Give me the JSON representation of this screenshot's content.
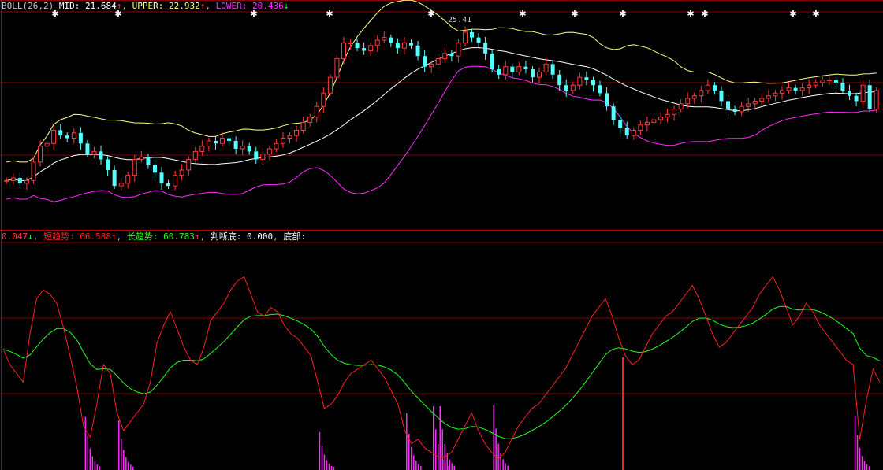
{
  "colors": {
    "background": "#000000",
    "grid": "#8b0000",
    "up_candle": "#ff3c3c",
    "down_candle": "#54ffff",
    "mid_band": "#ffffff",
    "upper_band": "#ffff80",
    "lower_band": "#ff2cff",
    "short_trend": "#ff2020",
    "long_trend": "#20ff20",
    "bottom_hist": "#ff2cff",
    "signal_line": "#ff2020"
  },
  "boll_header": {
    "name": "BOLL(26,2)",
    "mid_label": "MID:",
    "mid_value": "21.684",
    "mid_arrow": "↑",
    "upper_label": "UPPER:",
    "upper_value": "22.932",
    "upper_arrow": "↑",
    "lower_label": "LOWER:",
    "lower_value": "20.436",
    "lower_arrow": "↓"
  },
  "indicator_header": {
    "first_value": "0.047",
    "first_arrow": "↓",
    "short_label": "短趋势:",
    "short_value": "66.588",
    "short_arrow": "↑",
    "long_label": "长趋势:",
    "long_value": "60.783",
    "long_arrow": "↑",
    "judge_label": "判断底:",
    "judge_value": "0.000",
    "bottom_label": "底部:"
  },
  "price_annotation": "←25.41",
  "chart_data": {
    "type": "candlestick+indicator",
    "price_series": [
      19.6,
      19.7,
      19.5,
      19.6,
      20.3,
      20.9,
      21.0,
      21.5,
      21.3,
      21.2,
      21.4,
      21.0,
      20.6,
      20.7,
      20.4,
      20.0,
      19.4,
      19.5,
      19.8,
      20.4,
      20.5,
      20.2,
      19.9,
      19.5,
      19.4,
      19.8,
      20.0,
      20.4,
      20.7,
      20.9,
      21.1,
      21.0,
      21.2,
      21.1,
      20.8,
      20.9,
      20.7,
      20.4,
      20.6,
      20.8,
      21.0,
      21.2,
      21.3,
      21.5,
      21.8,
      22.0,
      22.4,
      22.9,
      23.5,
      24.2,
      24.8,
      24.8,
      24.6,
      24.5,
      24.7,
      24.9,
      25.0,
      24.8,
      24.6,
      24.8,
      24.7,
      24.3,
      23.9,
      24.0,
      24.2,
      24.4,
      24.3,
      24.8,
      25.2,
      25.0,
      24.8,
      24.4,
      23.8,
      23.6,
      23.9,
      23.7,
      23.9,
      23.8,
      23.5,
      23.7,
      24.0,
      23.6,
      23.2,
      23.0,
      23.2,
      23.5,
      23.4,
      23.2,
      22.9,
      22.4,
      21.9,
      21.6,
      21.3,
      21.5,
      21.7,
      21.8,
      21.9,
      22.0,
      22.1,
      22.3,
      22.5,
      22.7,
      22.8,
      23.0,
      23.2,
      23.0,
      22.6,
      22.3,
      22.2,
      22.4,
      22.5,
      22.6,
      22.7,
      22.8,
      22.9,
      23.0,
      23.1,
      23.0,
      23.1,
      23.2,
      23.3,
      23.4,
      23.4,
      23.3,
      23.0,
      22.8,
      22.6,
      23.2,
      22.3,
      23.0
    ],
    "short_trend": [
      55,
      48,
      44,
      40,
      62,
      78,
      82,
      80,
      76,
      65,
      52,
      38,
      20,
      15,
      30,
      48,
      44,
      26,
      18,
      22,
      26,
      30,
      40,
      58,
      66,
      72,
      64,
      56,
      50,
      48,
      56,
      68,
      72,
      76,
      82,
      86,
      88,
      80,
      72,
      70,
      74,
      72,
      66,
      62,
      60,
      56,
      52,
      40,
      28,
      30,
      34,
      40,
      44,
      46,
      48,
      50,
      46,
      42,
      36,
      30,
      18,
      12,
      14,
      10,
      8,
      6,
      6,
      8,
      14,
      20,
      26,
      18,
      12,
      8,
      5,
      8,
      14,
      20,
      24,
      28,
      30,
      34,
      38,
      42,
      46,
      52,
      58,
      64,
      70,
      74,
      78,
      70,
      60,
      52,
      48,
      50,
      56,
      62,
      66,
      70,
      72,
      76,
      80,
      84,
      78,
      70,
      62,
      56,
      58,
      62,
      66,
      70,
      74,
      80,
      84,
      88,
      82,
      74,
      66,
      70,
      76,
      72,
      66,
      62,
      58,
      54,
      50,
      48,
      14,
      32,
      46,
      40
    ]
  }
}
